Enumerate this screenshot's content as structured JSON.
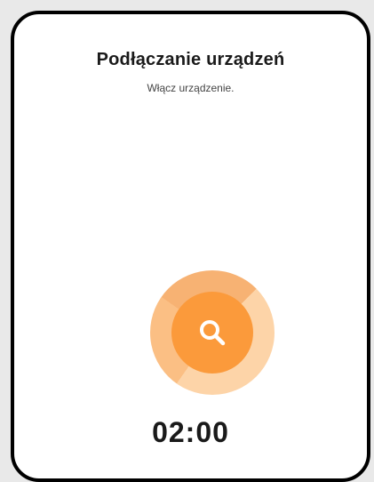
{
  "header": {
    "title": "Podłączanie urządzeń",
    "subtitle": "Włącz urządzenie."
  },
  "scanner": {
    "icon": "search-icon",
    "colors": {
      "inner": "#fb9a3b",
      "ring_light": "#fdd4a8",
      "ring_mid": "#f7b273"
    }
  },
  "timer": {
    "value": "02:00"
  }
}
